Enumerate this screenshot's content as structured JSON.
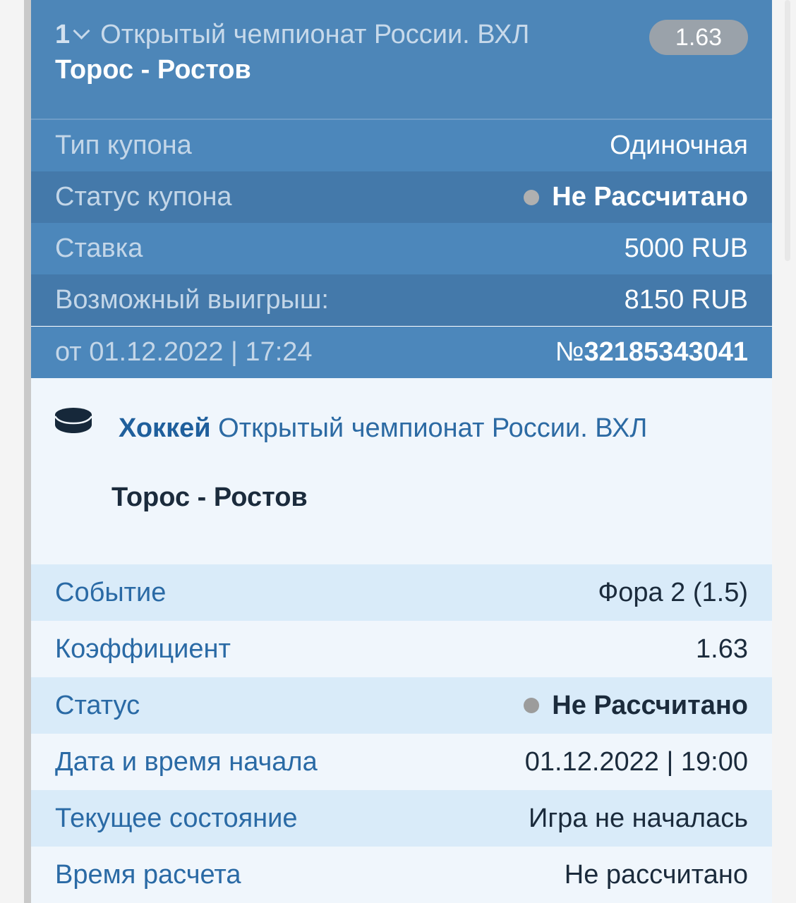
{
  "header": {
    "bet_index": "1",
    "tournament": "Открытый чемпионат России. ВХЛ",
    "match": "Торос - Ростов",
    "odds": "1.63"
  },
  "coupon": {
    "rows": [
      {
        "label": "Тип купона",
        "value": "Одиночная"
      },
      {
        "label": "Статус купона",
        "value": "Не Рассчитано"
      },
      {
        "label": "Ставка",
        "value": "5000 RUB"
      },
      {
        "label": "Возможный выигрыш:",
        "value": "8150 RUB"
      }
    ],
    "date_label": "от 01.12.2022 | 17:24",
    "number_prefix": "№",
    "number": "32185343041"
  },
  "event": {
    "sport": "Хоккей",
    "tournament": "Открытый чемпионат России. ВХЛ",
    "match": "Торос - Ростов",
    "icon": "hockey-puck-icon",
    "rows": [
      {
        "label": "Событие",
        "value": "Фора 2 (1.5)"
      },
      {
        "label": "Коэффициент",
        "value": "1.63"
      },
      {
        "label": "Статус",
        "value": "Не Рассчитано"
      },
      {
        "label": "Дата и время начала",
        "value": "01.12.2022 | 19:00"
      },
      {
        "label": "Текущее состояние",
        "value": "Игра не началась"
      },
      {
        "label": "Время расчета",
        "value": "Не рассчитано"
      }
    ]
  },
  "colors": {
    "header_bg": "#4d86b8",
    "row_dark": "#4479aa",
    "event_bg": "#f0f6fc",
    "event_row_alt": "#d9ebf9",
    "label_blue": "#2a6aa5",
    "status_dot": "#b0b0b0"
  }
}
